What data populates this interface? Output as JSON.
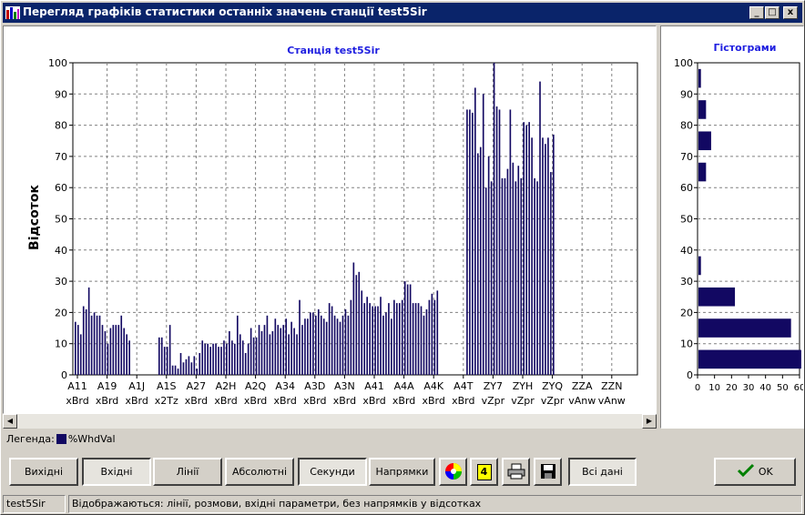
{
  "window": {
    "title": "Перегляд графіків статистики останніх значень станції test5Sir",
    "min_label": "_",
    "max_label": "□",
    "close_label": "x"
  },
  "legend": {
    "label": "Легенда:",
    "series_label": "%WhdVal"
  },
  "buttons": {
    "outgoing": "Вихідні",
    "incoming": "Вхідні",
    "lines": "Лінії",
    "absolute": "Абсолютні",
    "seconds": "Секунди",
    "directions": "Напрямки",
    "count_badge": "4",
    "all_data": "Всі дані",
    "ok": "OK"
  },
  "status": {
    "station": "test5Sir",
    "message": "Відображаються: лінії, розмови, вхідні параметри, без напрямків у відсотках"
  },
  "colors": {
    "bar": "#120862",
    "title": "#2020e0",
    "titlebar": "#0a246a"
  },
  "chart_data": [
    {
      "type": "bar",
      "title": "Станція test5Sir",
      "ylabel": "Відсоток",
      "ylim": [
        0,
        100
      ],
      "yticks": [
        0,
        10,
        20,
        30,
        40,
        50,
        60,
        70,
        80,
        90,
        100
      ],
      "x_tick_labels": [
        [
          "A11",
          "xBrd"
        ],
        [
          "A19",
          "xBrd"
        ],
        [
          "A1J",
          "xBrd"
        ],
        [
          "A1S",
          "x2Tz"
        ],
        [
          "A27",
          "xBrd"
        ],
        [
          "A2H",
          "xBrd"
        ],
        [
          "A2Q",
          "xBrd"
        ],
        [
          "A34",
          "xBrd"
        ],
        [
          "A3D",
          "xBrd"
        ],
        [
          "A3N",
          "xBrd"
        ],
        [
          "A41",
          "xBrd"
        ],
        [
          "A4A",
          "xBrd"
        ],
        [
          "A4K",
          "xBrd"
        ],
        [
          "A4T",
          "xBrd"
        ],
        [
          "ZY7",
          "vZpr"
        ],
        [
          "ZYH",
          "vZpr"
        ],
        [
          "ZYQ",
          "vZpr"
        ],
        [
          "ZZA",
          "vAnw"
        ],
        [
          "ZZN",
          "vAnw"
        ]
      ],
      "series": [
        {
          "name": "%WhdVal",
          "values": [
            17,
            16,
            13,
            22,
            21,
            28,
            19,
            20,
            19,
            19,
            16,
            14,
            10,
            15,
            16,
            16,
            16,
            19,
            15,
            13,
            11,
            0,
            0,
            0,
            0,
            0,
            0,
            0,
            0,
            0,
            0,
            12,
            12,
            9,
            9,
            16,
            3,
            3,
            2,
            7,
            4,
            5,
            6,
            4,
            6,
            2,
            7,
            11,
            10,
            10,
            9,
            10,
            10,
            9,
            9,
            11,
            10,
            14,
            11,
            10,
            19,
            13,
            11,
            7,
            10,
            15,
            12,
            12,
            16,
            14,
            16,
            19,
            13,
            14,
            18,
            16,
            15,
            16,
            18,
            13,
            17,
            15,
            13,
            24,
            16,
            18,
            18,
            20,
            20,
            19,
            21,
            19,
            18,
            17,
            23,
            22,
            19,
            18,
            17,
            19,
            21,
            19,
            24,
            36,
            32,
            33,
            27,
            23,
            25,
            23,
            22,
            22,
            22,
            25,
            19,
            20,
            23,
            18,
            24,
            23,
            23,
            24,
            30,
            29,
            29,
            23,
            23,
            23,
            22,
            19,
            21,
            24,
            26,
            24,
            27,
            0,
            0,
            0,
            0,
            0,
            0,
            0,
            0,
            0,
            0,
            85,
            85,
            84,
            92,
            71,
            73,
            90,
            60,
            70,
            62,
            100,
            86,
            85,
            63,
            63,
            66,
            85,
            68,
            62,
            67,
            63,
            81,
            80,
            81,
            76,
            63,
            62,
            94,
            76,
            74,
            76,
            65,
            77
          ]
        }
      ]
    },
    {
      "type": "bar",
      "orientation": "horizontal",
      "title": "Гістограми",
      "ylim": [
        0,
        100
      ],
      "yticks": [
        0,
        10,
        20,
        30,
        40,
        50,
        60,
        70,
        80,
        90,
        100
      ],
      "xticks": [
        0,
        10,
        20,
        30,
        40,
        50,
        60
      ],
      "bins": [
        [
          0,
          10
        ],
        [
          10,
          20
        ],
        [
          20,
          30
        ],
        [
          30,
          40
        ],
        [
          60,
          70
        ],
        [
          70,
          80
        ],
        [
          80,
          90
        ],
        [
          90,
          100
        ]
      ],
      "values": [
        61,
        55,
        22,
        2,
        5,
        8,
        5,
        2
      ]
    }
  ]
}
